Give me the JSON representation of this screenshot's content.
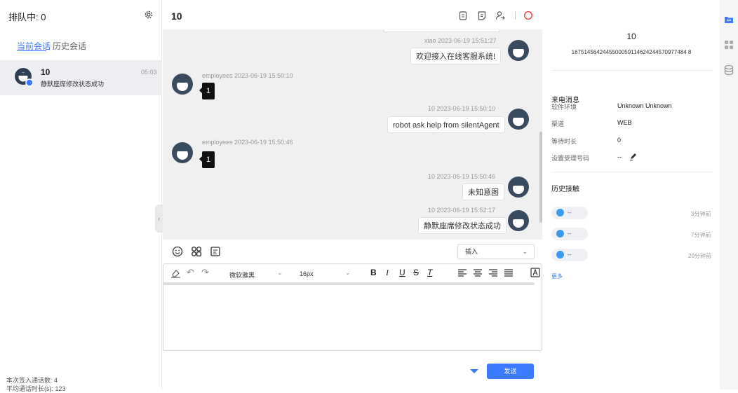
{
  "left": {
    "queue": "排队中: 0",
    "tabs": {
      "current": "当前会话",
      "history": "历史会话"
    },
    "conversation": {
      "name": "10",
      "message": "静默座席修改状态成功",
      "time": "05:03"
    },
    "stats": {
      "line1": "本次签入通话数: 4",
      "line2": "平均通话时长(s): 123"
    }
  },
  "middle": {
    "title": "10",
    "messages": [
      {
        "side": "right",
        "meta": "xiao  2023-06-19 15:51:27",
        "text": "欢迎接入在线客服系统!"
      },
      {
        "side": "left",
        "meta": "employees  2023-06-19 15:50:10",
        "text": "1"
      },
      {
        "side": "right",
        "meta": "10  2023-06-19 15:50:10",
        "text": "robot ask help from silentAgent"
      },
      {
        "side": "left",
        "meta": "employees  2023-06-19 15:50:46",
        "text": "1"
      },
      {
        "side": "right",
        "meta": "10  2023-06-19 15:50:46",
        "text": "未知意图"
      },
      {
        "side": "right",
        "meta": "10  2023-06-19 15:52:17",
        "text": "静默座席修改状态成功"
      }
    ],
    "insert_select": "插入",
    "font_family": "微软雅黑",
    "font_size": "16px",
    "send_label": "发送"
  },
  "right": {
    "id": "10",
    "number": "1675145642445500059114624244570977484 8",
    "call_title": "来电消息",
    "fields": [
      {
        "label": "软件环境",
        "value": "Unknown Unknown"
      },
      {
        "label": "渠道",
        "value": "WEB"
      },
      {
        "label": "等待时长",
        "value": "0"
      },
      {
        "label": "设置受理号码",
        "value": "--"
      }
    ],
    "history_title": "历史接触",
    "history": [
      {
        "text": "--",
        "ago": "3分钟前"
      },
      {
        "text": "--",
        "ago": "7分钟前"
      },
      {
        "text": "--",
        "ago": "20分钟前"
      }
    ],
    "more": "更多"
  },
  "colors": {
    "accent": "#3a7bff",
    "dot": "#3a9bf0",
    "close": "#f03c3c"
  }
}
